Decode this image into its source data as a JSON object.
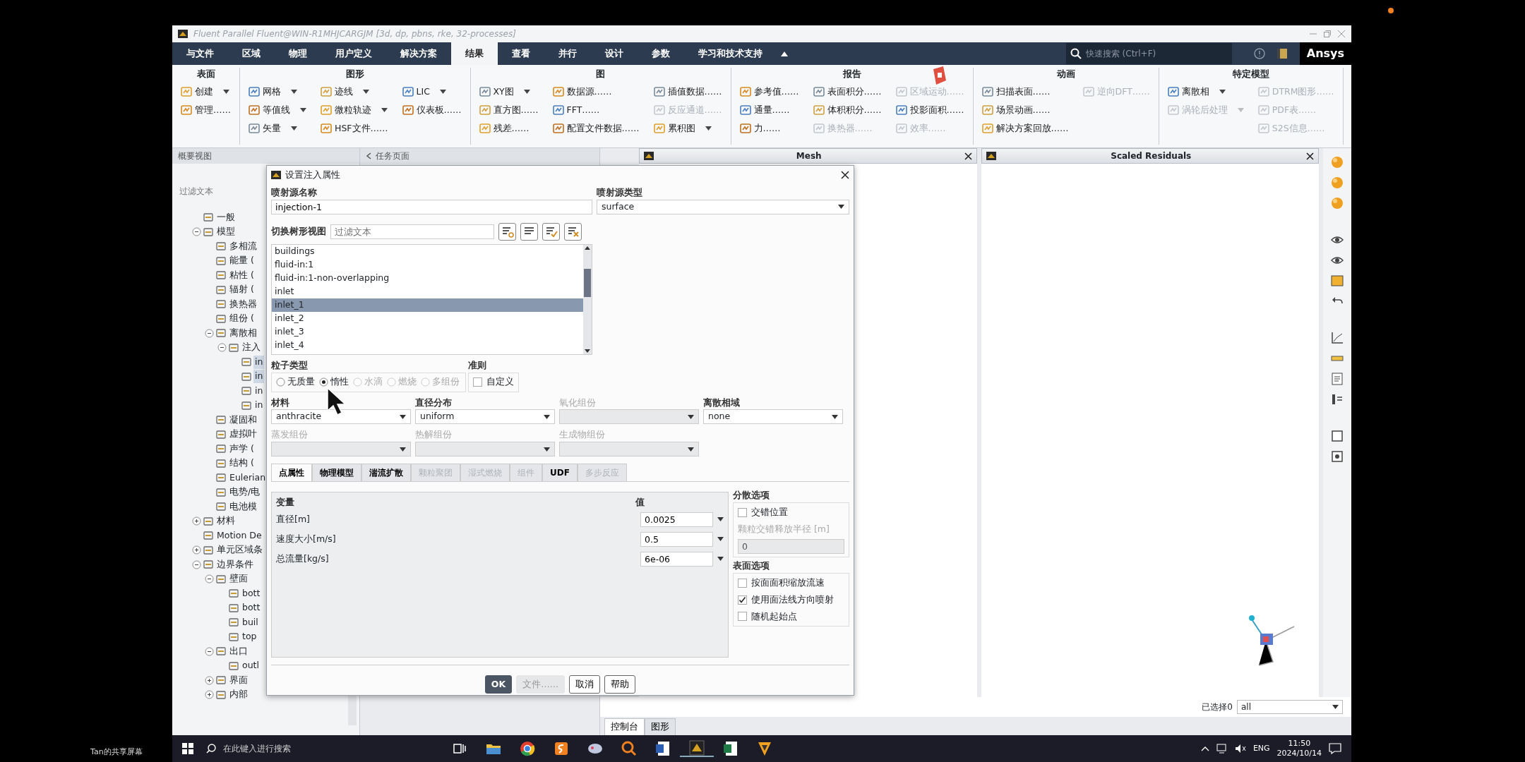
{
  "screen_share_label": "Tan的共享屏幕",
  "window": {
    "title": "Fluent Parallel Fluent@WIN-R1MHJCARGJM  [3d, dp, pbns, rke, 32-processes]"
  },
  "menu": {
    "tabs": [
      {
        "label": "与文件",
        "selected": false
      },
      {
        "label": "区域",
        "selected": false
      },
      {
        "label": "物理",
        "selected": false
      },
      {
        "label": "用户定义",
        "selected": false
      },
      {
        "label": "解决方案",
        "selected": false
      },
      {
        "label": "结果",
        "selected": true
      },
      {
        "label": "查看",
        "selected": false
      },
      {
        "label": "并行",
        "selected": false
      },
      {
        "label": "设计",
        "selected": false
      },
      {
        "label": "参数",
        "selected": false
      },
      {
        "label": "学习和技术支持",
        "selected": false
      }
    ],
    "search": {
      "placeholder": "快速搜索 (Ctrl+F)"
    },
    "brand": "Ansys"
  },
  "ribbon": {
    "groups": [
      {
        "title": "表面",
        "columns": [
          [
            {
              "label": "创建",
              "dropdown": true,
              "disabled": false
            },
            {
              "label": "管理……",
              "dropdown": false,
              "disabled": false
            }
          ]
        ]
      },
      {
        "title": "图形",
        "columns": [
          [
            {
              "label": "网格",
              "dropdown": true,
              "disabled": false
            },
            {
              "label": "等值线",
              "dropdown": true,
              "disabled": false
            },
            {
              "label": "矢量",
              "dropdown": true,
              "disabled": false
            }
          ],
          [
            {
              "label": "迹线",
              "dropdown": true,
              "disabled": false
            },
            {
              "label": "微粒轨迹",
              "dropdown": true,
              "disabled": false
            },
            {
              "label": "HSF文件……",
              "dropdown": false,
              "disabled": false
            }
          ],
          [
            {
              "label": "LIC",
              "dropdown": true,
              "disabled": false
            },
            {
              "label": "仪表板……",
              "dropdown": false,
              "disabled": false
            }
          ]
        ]
      },
      {
        "title": "图",
        "columns": [
          [
            {
              "label": "XY图",
              "dropdown": true,
              "disabled": false
            },
            {
              "label": "直方图……",
              "dropdown": false,
              "disabled": false
            },
            {
              "label": "残差……",
              "dropdown": false,
              "disabled": false
            }
          ],
          [
            {
              "label": "数据源……",
              "dropdown": false,
              "disabled": false
            },
            {
              "label": "FFT……",
              "dropdown": false,
              "disabled": false
            },
            {
              "label": "配置文件数据……",
              "dropdown": false,
              "disabled": false
            }
          ],
          [
            {
              "label": "插值数据……",
              "dropdown": false,
              "disabled": false
            },
            {
              "label": "反应通道……",
              "dropdown": false,
              "disabled": true
            },
            {
              "label": "累积图",
              "dropdown": true,
              "disabled": false
            }
          ]
        ]
      },
      {
        "title": "报告",
        "columns": [
          [
            {
              "label": "参考值……",
              "dropdown": false,
              "disabled": false
            },
            {
              "label": "通量……",
              "dropdown": false,
              "disabled": false
            },
            {
              "label": "力……",
              "dropdown": false,
              "disabled": false
            }
          ],
          [
            {
              "label": "表面积分……",
              "dropdown": false,
              "disabled": false
            },
            {
              "label": "体积积分……",
              "dropdown": false,
              "disabled": false
            },
            {
              "label": "换热器……",
              "dropdown": false,
              "disabled": true
            }
          ],
          [
            {
              "label": "区域运动……",
              "dropdown": false,
              "disabled": true
            },
            {
              "label": "投影面积……",
              "dropdown": false,
              "disabled": false
            },
            {
              "label": "效率……",
              "dropdown": false,
              "disabled": true
            }
          ]
        ]
      },
      {
        "title": "动画",
        "columns": [
          [
            {
              "label": "扫描表面……",
              "dropdown": false,
              "disabled": false
            },
            {
              "label": "场景动画……",
              "dropdown": false,
              "disabled": false
            },
            {
              "label": "解决方案回放……",
              "dropdown": false,
              "disabled": false
            }
          ],
          [
            {
              "label": "逆向DFT……",
              "dropdown": false,
              "disabled": true
            }
          ]
        ]
      },
      {
        "title": "特定模型",
        "columns": [
          [
            {
              "label": "离散相",
              "dropdown": true,
              "disabled": false
            },
            {
              "label": "涡轮后处理",
              "dropdown": true,
              "disabled": true
            }
          ],
          [
            {
              "label": "DTRM图形……",
              "dropdown": false,
              "disabled": true
            },
            {
              "label": "PDF表……",
              "dropdown": false,
              "disabled": true
            },
            {
              "label": "S2S信息……",
              "dropdown": false,
              "disabled": true
            }
          ]
        ]
      }
    ]
  },
  "tree": {
    "header": "概要视图",
    "filter_placeholder": "过滤文本",
    "items": [
      {
        "label": "一般",
        "selected": false
      },
      {
        "label": "模型",
        "selected": false,
        "expanded": true,
        "children": [
          {
            "label": "多相流",
            "selected": false
          },
          {
            "label": "能量 (",
            "selected": false
          },
          {
            "label": "粘性 (",
            "selected": false
          },
          {
            "label": "辐射 (",
            "selected": false
          },
          {
            "label": "换热器",
            "selected": false
          },
          {
            "label": "组份 (",
            "selected": false
          },
          {
            "label": "离散相",
            "selected": false,
            "expanded": true,
            "children": [
              {
                "label": "注入",
                "selected": false,
                "expanded": true,
                "children": [
                  {
                    "label": "in",
                    "selected": true
                  },
                  {
                    "label": "in",
                    "selected": true
                  },
                  {
                    "label": "in",
                    "selected": false
                  },
                  {
                    "label": "in",
                    "selected": false
                  }
                ]
              }
            ]
          },
          {
            "label": "凝固和",
            "selected": false
          },
          {
            "label": "虚拟叶",
            "selected": false
          },
          {
            "label": "声学 (",
            "selected": false
          },
          {
            "label": "结构 (",
            "selected": false
          },
          {
            "label": "Eulerian",
            "selected": false
          },
          {
            "label": "电势/电",
            "selected": false
          },
          {
            "label": "电池模",
            "selected": false
          }
        ]
      },
      {
        "label": "材料",
        "selected": false,
        "expanded": false
      },
      {
        "label": "Motion De",
        "selected": false
      },
      {
        "label": "单元区域条",
        "selected": false,
        "expanded": false
      },
      {
        "label": "边界条件",
        "selected": false,
        "expanded": true,
        "children": [
          {
            "label": "壁面",
            "selected": false,
            "expanded": true,
            "children": [
              {
                "label": "bott",
                "selected": false
              },
              {
                "label": "bott",
                "selected": false
              },
              {
                "label": "buil",
                "selected": false
              },
              {
                "label": "top",
                "selected": false
              }
            ]
          },
          {
            "label": "出口",
            "selected": false,
            "expanded": true,
            "children": [
              {
                "label": "outl",
                "selected": false
              }
            ]
          },
          {
            "label": "界面",
            "selected": false,
            "expanded": false
          },
          {
            "label": "内部",
            "selected": false,
            "expanded": false
          }
        ]
      }
    ]
  },
  "task_panel": {
    "title": "任务页面"
  },
  "graphics_tabs": [
    {
      "title": "Mesh"
    },
    {
      "title": "Scaled Residuals"
    }
  ],
  "dialog": {
    "title": "设置注入属性",
    "name": {
      "label": "喷射源名称",
      "value": "injection-1"
    },
    "type": {
      "label": "喷射源类型",
      "value": "surface"
    },
    "tree_toggle": {
      "label": "切换树形视图",
      "placeholder": "过滤文本"
    },
    "surfaces": [
      {
        "label": "buildings",
        "selected": false
      },
      {
        "label": "fluid-in:1",
        "selected": false
      },
      {
        "label": "fluid-in:1-non-overlapping",
        "selected": false
      },
      {
        "label": "inlet",
        "selected": false
      },
      {
        "label": "inlet_1",
        "selected": true
      },
      {
        "label": "inlet_2",
        "selected": false
      },
      {
        "label": "inlet_3",
        "selected": false
      },
      {
        "label": "inlet_4",
        "selected": false
      }
    ],
    "particle_type": {
      "label": "粒子类型",
      "options": [
        {
          "label": "无质量",
          "selected": false,
          "disabled": false
        },
        {
          "label": "惰性",
          "selected": true,
          "disabled": false
        },
        {
          "label": "水滴",
          "selected": false,
          "disabled": true
        },
        {
          "label": "燃烧",
          "selected": false,
          "disabled": true
        },
        {
          "label": "多组份",
          "selected": false,
          "disabled": true
        }
      ]
    },
    "criteria": {
      "label": "准则",
      "option": {
        "label": "自定义",
        "checked": false
      }
    },
    "selects": [
      {
        "label": "材料",
        "value": "anthracite",
        "disabled": false
      },
      {
        "label": "直径分布",
        "value": "uniform",
        "disabled": false
      },
      {
        "label": "氧化组份",
        "disabled": true
      },
      {
        "label": "离散相域",
        "value": "none",
        "disabled": false
      },
      {
        "label": "蒸发组份",
        "disabled": true
      },
      {
        "label": "热解组份",
        "disabled": true
      },
      {
        "label": "生成物组份",
        "disabled": true
      }
    ],
    "tabs": [
      {
        "label": "点属性",
        "selected": true,
        "disabled": false
      },
      {
        "label": "物理模型",
        "selected": false,
        "disabled": false
      },
      {
        "label": "湍流扩散",
        "selected": false,
        "disabled": false
      },
      {
        "label": "颗粒聚团",
        "selected": false,
        "disabled": true
      },
      {
        "label": "湿式燃烧",
        "selected": false,
        "disabled": true
      },
      {
        "label": "组件",
        "selected": false,
        "disabled": true
      },
      {
        "label": "UDF",
        "selected": false,
        "disabled": false
      },
      {
        "label": "多步反应",
        "selected": false,
        "disabled": true
      }
    ],
    "table": {
      "columns": [
        "变量",
        "值"
      ],
      "rows": [
        {
          "variable": "直径[m]",
          "value": "0.0025"
        },
        {
          "variable": "速度大小[m/s]",
          "value": "0.5"
        },
        {
          "variable": "总流量[kg/s]",
          "value": "6e-06"
        }
      ]
    },
    "dispersion": {
      "title": "分散选项",
      "option": {
        "label": "交错位置",
        "checked": false
      },
      "radius": {
        "label": "颗粒交错释放半径 [m]",
        "value": "0",
        "disabled": true
      }
    },
    "surface_options": {
      "title": "表面选项",
      "options": [
        {
          "label": "按面面积缩放流速",
          "checked": false
        },
        {
          "label": "使用面法线方向喷射",
          "checked": true
        },
        {
          "label": "随机起始点",
          "checked": false
        }
      ]
    },
    "buttons": [
      {
        "label": "OK",
        "kind": "primary",
        "disabled": false
      },
      {
        "label": "文件……",
        "kind": "normal",
        "disabled": true
      },
      {
        "label": "取消",
        "kind": "normal",
        "disabled": false
      },
      {
        "label": "帮助",
        "kind": "normal",
        "disabled": false
      }
    ]
  },
  "console_tabs": [
    {
      "label": "控制台",
      "selected": true
    },
    {
      "label": "图形",
      "selected": false
    }
  ],
  "selection": {
    "label": "已选择0",
    "value": "all"
  },
  "taskbar": {
    "search_placeholder": "在此键入进行搜索",
    "language": "ENG",
    "time": "11:50",
    "date": "2024/10/14"
  }
}
